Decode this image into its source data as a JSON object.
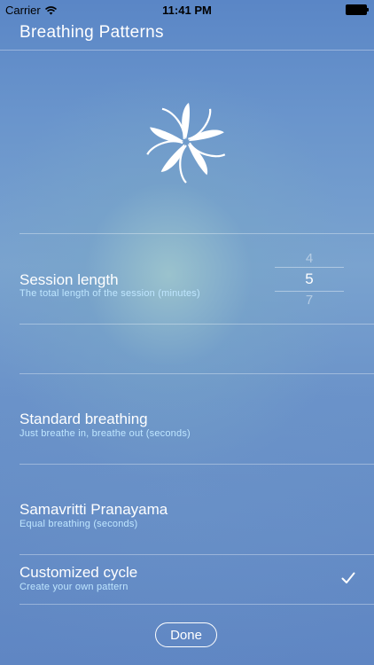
{
  "status_bar": {
    "carrier": "Carrier",
    "time": "11:41 PM"
  },
  "header": {
    "title": "Breathing Patterns"
  },
  "session": {
    "title": "Session length",
    "subtitle": "The total length of the session (minutes)",
    "picker": {
      "previous": "4",
      "selected": "5",
      "next": "7"
    }
  },
  "patterns": [
    {
      "title": "Standard breathing",
      "subtitle": "Just breathe in, breathe out (seconds)"
    },
    {
      "title": "Samavritti Pranayama",
      "subtitle": "Equal breathing (seconds)"
    },
    {
      "title": "Customized cycle",
      "subtitle": "Create your own pattern",
      "selected": true
    }
  ],
  "done_label": "Done",
  "icons": {
    "logo": "flower-icon",
    "wifi": "wifi-icon",
    "battery": "battery-icon",
    "check": "checkmark-icon"
  }
}
